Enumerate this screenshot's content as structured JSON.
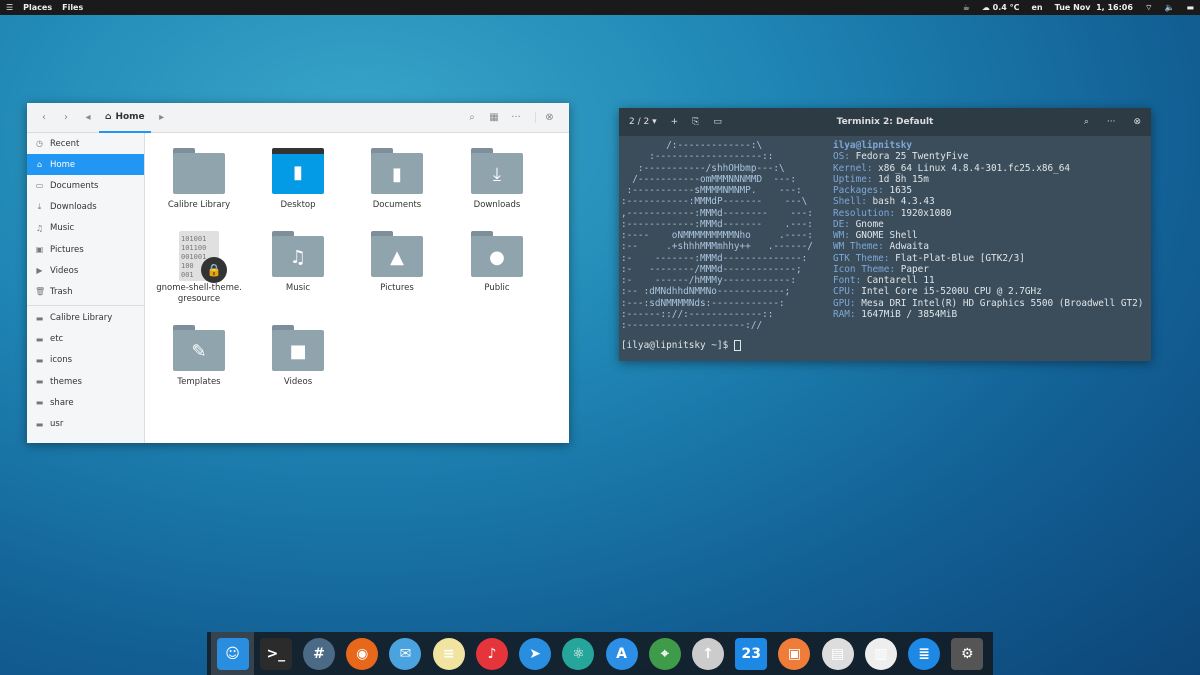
{
  "topbar": {
    "menu_icon": "hamburger-icon",
    "places": "Places",
    "files": "Files",
    "weather_temp": "0.4 °C",
    "lang": "en",
    "clock": "Tue Nov  1, 16:06"
  },
  "file_manager": {
    "location": "Home",
    "sidebar": [
      {
        "label": "Recent",
        "icon": "clock-icon",
        "g": "◷"
      },
      {
        "label": "Home",
        "icon": "home-icon",
        "g": "⌂",
        "selected": true
      },
      {
        "label": "Documents",
        "icon": "documents-icon",
        "g": "▭"
      },
      {
        "label": "Downloads",
        "icon": "download-icon",
        "g": "⤓"
      },
      {
        "label": "Music",
        "icon": "music-icon",
        "g": "♫"
      },
      {
        "label": "Pictures",
        "icon": "pictures-icon",
        "g": "▣"
      },
      {
        "label": "Videos",
        "icon": "video-icon",
        "g": "▶"
      },
      {
        "label": "Trash",
        "icon": "trash-icon",
        "g": "🗑"
      }
    ],
    "bookmarks": [
      "Calibre Library",
      "etc",
      "icons",
      "themes",
      "share",
      "usr"
    ],
    "items": [
      {
        "label": "Calibre Library",
        "g": ""
      },
      {
        "label": "Desktop",
        "g": "desktop"
      },
      {
        "label": "Documents",
        "g": "▮"
      },
      {
        "label": "Downloads",
        "g": "⤓"
      },
      {
        "label": "gnome-shell-theme.\ngresource",
        "g": "binary"
      },
      {
        "label": "Music",
        "g": "♫"
      },
      {
        "label": "Pictures",
        "g": "▲"
      },
      {
        "label": "Public",
        "g": "●"
      },
      {
        "label": "Templates",
        "g": "✎"
      },
      {
        "label": "Videos",
        "g": "■"
      }
    ]
  },
  "terminal": {
    "title": "Terminix 2: Default",
    "session": "2 / 2",
    "ascii": [
      "        /:-------------:\\",
      "     :-------------------::",
      "   :-----------/shhOHbmp---:\\",
      "  /-----------omMMMNNNMMD  ---:",
      " :-----------sMMMMNMNMP.    ---:",
      ":-----------:MMMdP-------    ---\\",
      ",------------:MMMd--------    ---:",
      ":------------:MMMd-------    .---:",
      ":----    oNMMMMMMMMMNho     .----:",
      ":--     .+shhhMMMmhhy++   .------/",
      ":-    -------:MMMd--------------:",
      ":-   --------/MMMd-------------;",
      ":-    ------/hMMMy------------:",
      ":-- :dMNdhhdNMMNo------------;",
      ":---:sdNMMMMNds:------------:",
      ":------:://:-------------::",
      ":---------------------://"
    ],
    "user": "ilya@lipnitsky",
    "info": [
      [
        "OS: ",
        "Fedora 25 TwentyFive"
      ],
      [
        "Kernel: ",
        "x86_64 Linux 4.8.4-301.fc25.x86_64"
      ],
      [
        "Uptime: ",
        "1d 8h 15m"
      ],
      [
        "Packages: ",
        "1635"
      ],
      [
        "Shell: ",
        "bash 4.3.43"
      ],
      [
        "Resolution: ",
        "1920x1080"
      ],
      [
        "DE: ",
        "Gnome"
      ],
      [
        "WM: ",
        "GNOME Shell"
      ],
      [
        "WM Theme: ",
        "Adwaita"
      ],
      [
        "GTK Theme: ",
        "Flat-Plat-Blue [GTK2/3]"
      ],
      [
        "Icon Theme: ",
        "Paper"
      ],
      [
        "Font: ",
        "Cantarell 11"
      ],
      [
        "CPU: ",
        "Intel Core i5-5200U CPU @ 2.7GHz"
      ],
      [
        "GPU: ",
        "Mesa DRI Intel(R) HD Graphics 5500 (Broadwell GT2)"
      ],
      [
        "RAM: ",
        "1647MiB / 3854MiB"
      ]
    ],
    "prompt": "[ilya@lipnitsky ~]$ "
  },
  "dock": [
    {
      "name": "files",
      "color": "#2a8ee0",
      "g": "☺"
    },
    {
      "name": "terminal",
      "color": "#2b2b2b",
      "g": ">_"
    },
    {
      "name": "chat",
      "color": "#4a6a86",
      "g": "#"
    },
    {
      "name": "firefox",
      "color": "#e8681b",
      "g": "◉"
    },
    {
      "name": "mail",
      "color": "#4aa3df",
      "g": "✉"
    },
    {
      "name": "notes",
      "color": "#f1e3a0",
      "g": "≡"
    },
    {
      "name": "music",
      "color": "#e5343a",
      "g": "♪"
    },
    {
      "name": "send",
      "color": "#2a8ee0",
      "g": "➤"
    },
    {
      "name": "atom",
      "color": "#26a69a",
      "g": "⚛"
    },
    {
      "name": "app-store",
      "color": "#2c8fe5",
      "g": "A"
    },
    {
      "name": "maps",
      "color": "#3d9b4a",
      "g": "⌖"
    },
    {
      "name": "updates",
      "color": "#ccc",
      "g": "↑"
    },
    {
      "name": "calendar",
      "color": "#1e88e5",
      "g": "23"
    },
    {
      "name": "photos",
      "color": "#f07c3a",
      "g": "▣"
    },
    {
      "name": "documents",
      "color": "#ddd",
      "g": "▤"
    },
    {
      "name": "books",
      "color": "#eee",
      "g": "▥"
    },
    {
      "name": "text-editor",
      "color": "#1e88e5",
      "g": "≣"
    },
    {
      "name": "settings",
      "color": "#555",
      "g": "⚙"
    }
  ]
}
